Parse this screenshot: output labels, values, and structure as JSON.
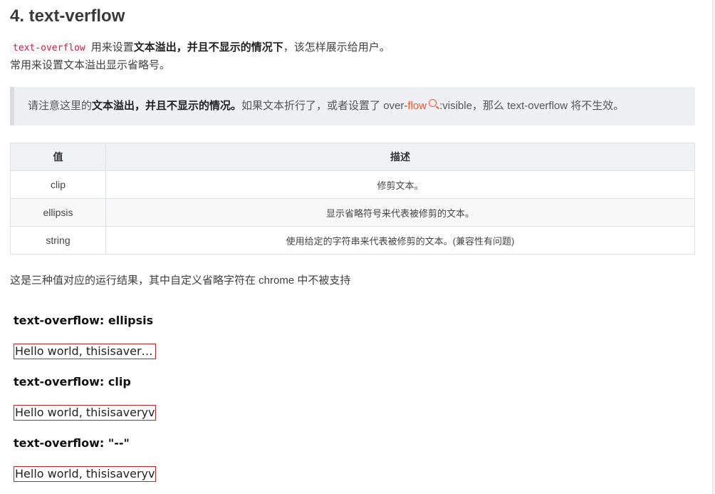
{
  "heading": "4. text-verflow",
  "intro": {
    "code": "text-overflow",
    "text_before": "用来设置",
    "bold": "文本溢出，并且不显示的情况下",
    "text_after": "，该怎样展示给用户。",
    "line2": "常用来设置文本溢出显示省略号。"
  },
  "note": {
    "prefix": "请注意这里的",
    "bold": "文本溢出，并且不显示的情况。",
    "middle": "如果文本折行了，或者设置了 over-",
    "link": "flow",
    "suffix": ":visible，那么 text-overflow 将不生效。"
  },
  "table": {
    "headers": [
      "值",
      "描述"
    ],
    "rows": [
      {
        "value": "clip",
        "desc": "修剪文本。"
      },
      {
        "value": "ellipsis",
        "desc": "显示省略符号来代表被修剪的文本。"
      },
      {
        "value": "string",
        "desc": "使用给定的字符串来代表被修剪的文本。(兼容性有问题)"
      }
    ]
  },
  "summary": "这是三种值对应的运行结果，其中自定义省略字符在 chrome 中不被支持",
  "demos": [
    {
      "label": "text-overflow: ellipsis",
      "text": "Hello world, thisisaveryverylongwordthatoverflows"
    },
    {
      "label": "text-overflow: clip",
      "text": "Hello world, thisisaveryverylongwordthatoverflows"
    },
    {
      "label": "text-overflow: \"--\"",
      "text": "Hello world, thisisaveryverylongwordthatoverflows"
    }
  ],
  "colors": {
    "accent": "#fc5531",
    "code": "#c7254e",
    "demo_border": "#d01e1e"
  }
}
